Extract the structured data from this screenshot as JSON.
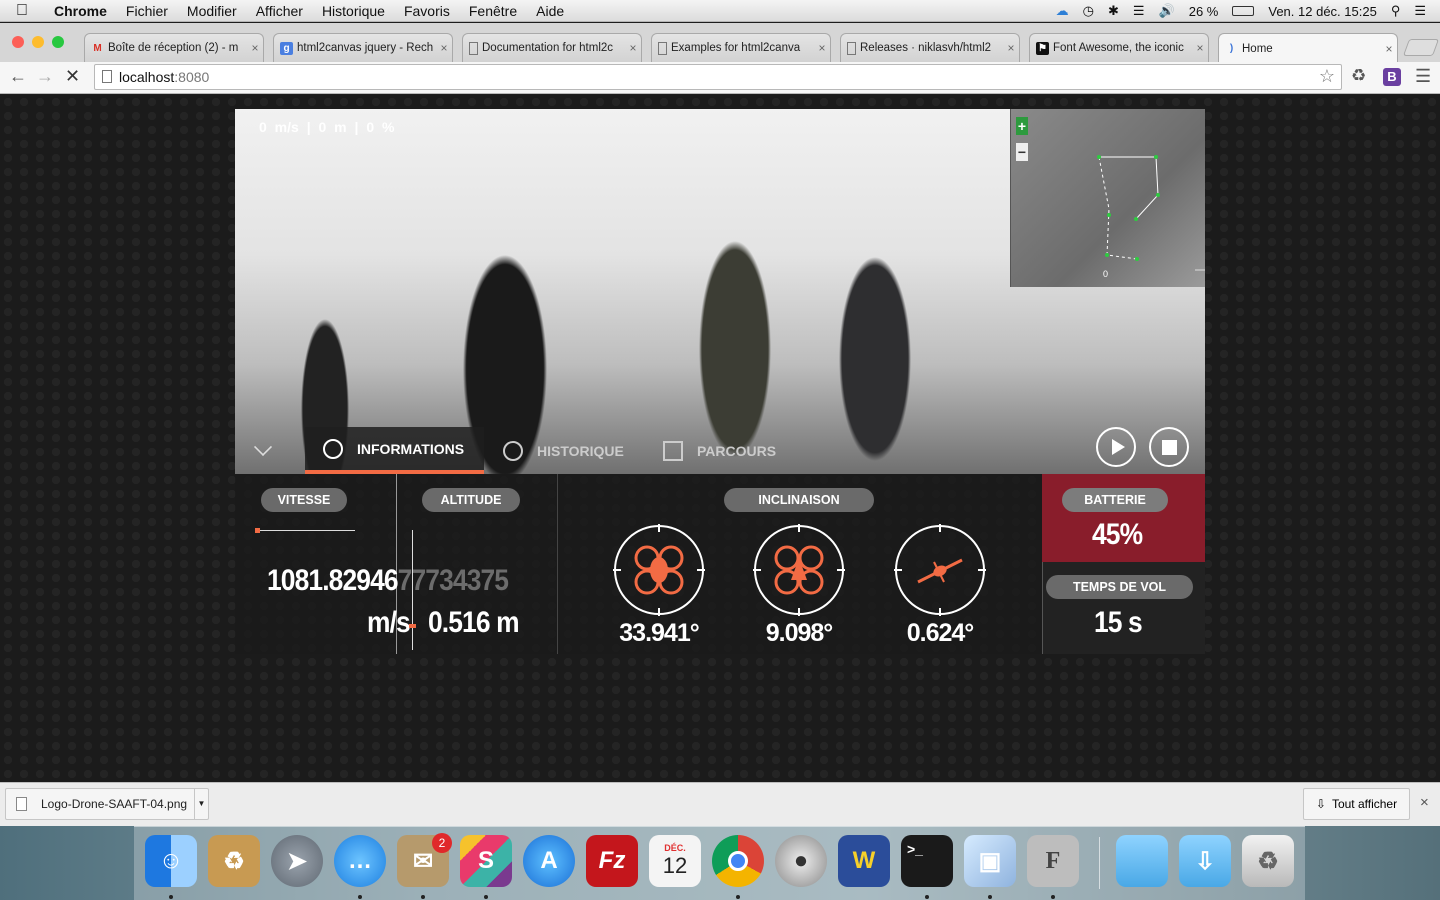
{
  "menubar": {
    "items": [
      "Chrome",
      "Fichier",
      "Modifier",
      "Afficher",
      "Historique",
      "Favoris",
      "Fenêtre",
      "Aide"
    ],
    "battery": "26 %",
    "datetime": "Ven. 12 déc.  15:25"
  },
  "tabs": [
    {
      "title": "Boîte de réception (2) - m",
      "icon": "gmail-icon"
    },
    {
      "title": "html2canvas jquery - Rech",
      "icon": "google-icon"
    },
    {
      "title": "Documentation for html2c",
      "icon": "page-icon"
    },
    {
      "title": "Examples for html2canva",
      "icon": "page-icon"
    },
    {
      "title": "Releases · niklasvh/html2",
      "icon": "page-icon"
    },
    {
      "title": "Font Awesome, the iconic",
      "icon": "flag-icon"
    },
    {
      "title": "Home",
      "icon": "loading-icon",
      "active": true
    }
  ],
  "toolbar": {
    "url_host": "localhost",
    "url_port": ":8080"
  },
  "drone": {
    "stats_line": "0 m/s  |  0 m  |  0 %",
    "panel_tabs": [
      "INFORMATIONS",
      "HISTORIQUE",
      "PARCOURS"
    ],
    "labels": {
      "speed": "VITESSE",
      "altitude": "ALTITUDE",
      "tilt": "INCLINAISON",
      "battery": "BATTERIE",
      "flight_time": "TEMPS DE VOL"
    },
    "speed_value": "1081.82946",
    "speed_value_overflow": "77734375",
    "speed_unit": "m/s",
    "altitude_value": "0.516 m",
    "tilt_values": [
      "33.941°",
      "9.098°",
      "0.624°"
    ],
    "battery_value": "45%",
    "battery_level": 0.45,
    "flight_time_value": "15 s",
    "minimap": {
      "origin_label": "0",
      "zoom_in": "+",
      "zoom_out": "−"
    }
  },
  "downloads": {
    "file": "Logo-Drone-SAAFT-04.png",
    "show_all": "Tout afficher"
  },
  "dock": {
    "mail_badge": "2",
    "calendar_month": "DÉC.",
    "calendar_day": "12"
  },
  "colors": {
    "accent": "#f26b44",
    "battery_bg": "#96202d",
    "pill_bg": "#6a6a6a"
  }
}
